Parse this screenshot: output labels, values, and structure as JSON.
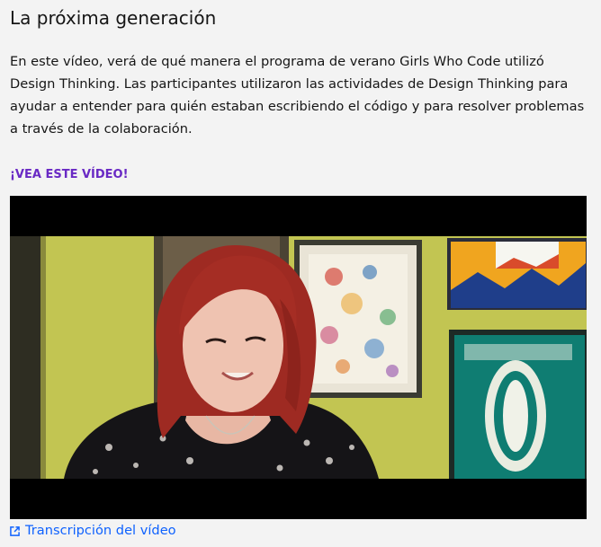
{
  "section": {
    "title": "La próxima generación",
    "description": "En este vídeo, verá de qué manera el programa de verano Girls Who Code utilizó Design Thinking. Las participantes utilizaron las actividades de Design Thinking para ayudar a entender para quién estaban escribiendo el código y para resolver problemas a través de la colaboración.",
    "cta_label": "¡VEA ESTE VÍDEO!",
    "transcript_label": "Transcripción del vídeo",
    "transcript_icon": "external-link-icon"
  },
  "colors": {
    "page_background": "#f3f3f3",
    "text": "#161616",
    "cta": "#6929c4",
    "link": "#0f62fe",
    "video_letterbox": "#000000",
    "wall": "#c7c958"
  }
}
